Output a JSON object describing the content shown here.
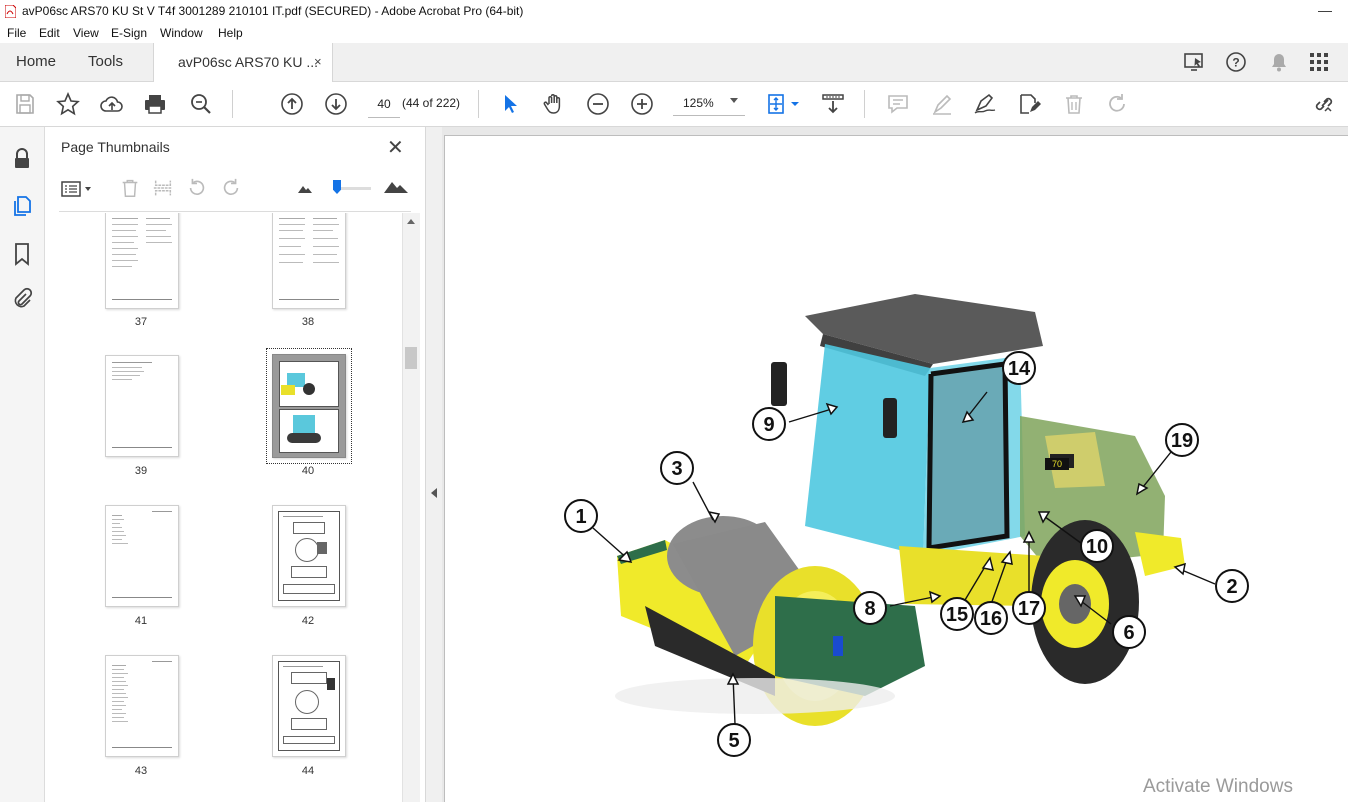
{
  "window": {
    "title": "avP06sc ARS70 KU St V T4f 3001289 210101 IT.pdf (SECURED) - Adobe Acrobat Pro (64-bit)",
    "minimize_glyph": "—"
  },
  "menu": [
    "File",
    "Edit",
    "View",
    "E-Sign",
    "Window",
    "Help"
  ],
  "tabs": {
    "home": "Home",
    "tools": "Tools",
    "document": "avP06sc ARS70 KU ...",
    "close_glyph": "×"
  },
  "toolbar": {
    "page_number": "40",
    "page_count": "(44 of 222)",
    "zoom": "125%"
  },
  "thumbnails_panel": {
    "title": "Page Thumbnails",
    "close_glyph": "✕",
    "pages": [
      {
        "label": "37",
        "selected": false,
        "kind": "text"
      },
      {
        "label": "38",
        "selected": false,
        "kind": "text"
      },
      {
        "label": "39",
        "selected": false,
        "kind": "sparse"
      },
      {
        "label": "40",
        "selected": true,
        "kind": "image"
      },
      {
        "label": "41",
        "selected": false,
        "kind": "list"
      },
      {
        "label": "42",
        "selected": false,
        "kind": "diagram"
      },
      {
        "label": "43",
        "selected": false,
        "kind": "list"
      },
      {
        "label": "44",
        "selected": false,
        "kind": "diagram"
      }
    ]
  },
  "document": {
    "callouts": [
      "1",
      "2",
      "3",
      "5",
      "6",
      "8",
      "9",
      "10",
      "14",
      "15",
      "16",
      "17",
      "19"
    ],
    "machine_decal": "70"
  },
  "watermark": "Activate Windows",
  "colors": {
    "accent_blue": "#1473e6",
    "roller_yellow": "#f0ea2a",
    "cab_glass": "#4fc8e0",
    "panel_bg": "#f5f5f5"
  },
  "icons": {
    "toolbar": [
      "save-icon",
      "bookmark-star-icon",
      "upload-cloud-icon",
      "print-icon",
      "zoom-search-icon",
      "page-up-icon",
      "page-down-icon",
      "select-cursor-icon",
      "hand-icon",
      "zoom-out-icon",
      "zoom-in-icon",
      "fit-page-icon",
      "scroll-mode-icon",
      "comment-icon",
      "highlight-icon",
      "sign-icon",
      "edit-pdf-icon",
      "delete-icon",
      "redo-icon",
      "share-link-icon"
    ],
    "left_rail": [
      "lock-icon",
      "pages-icon",
      "bookmark-icon",
      "attachment-icon"
    ]
  }
}
